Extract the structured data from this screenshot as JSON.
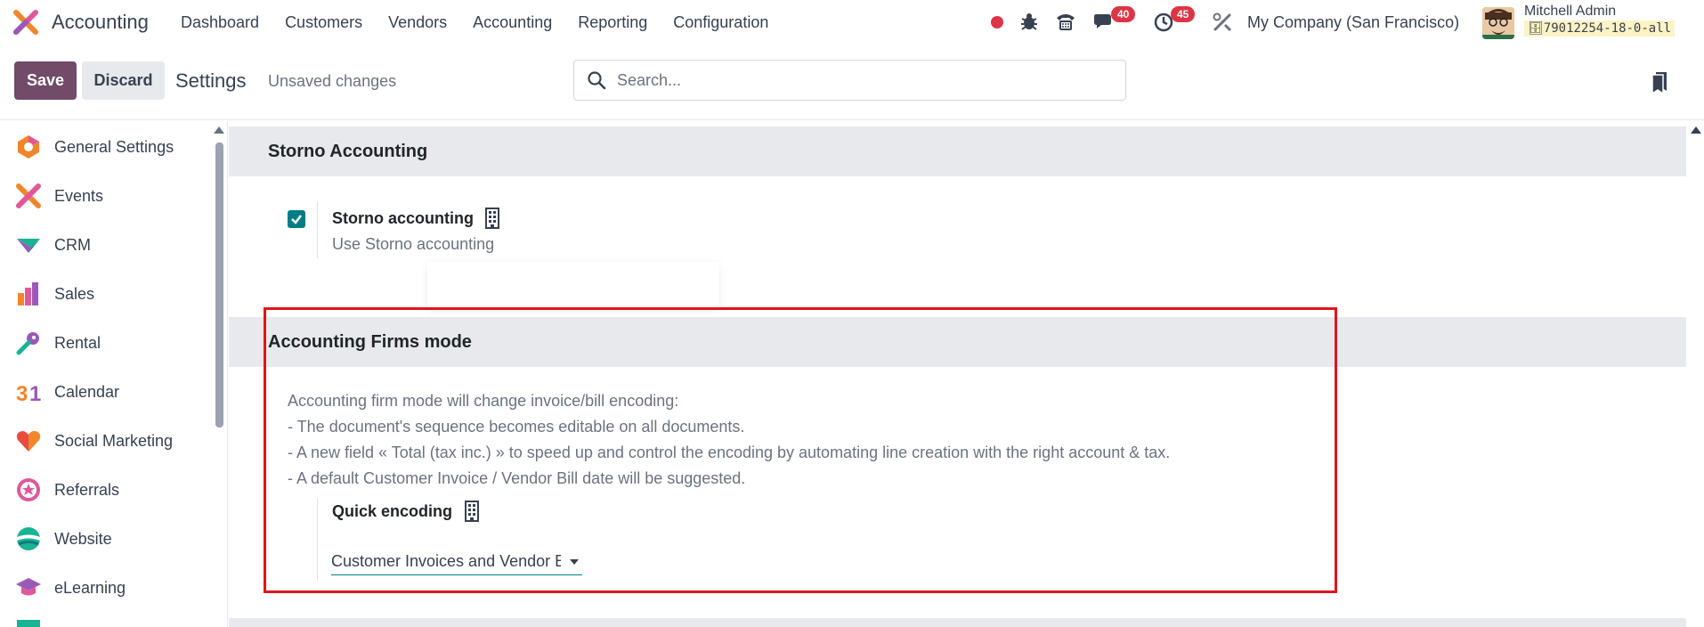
{
  "topnav": {
    "app_name": "Accounting",
    "menu": [
      "Dashboard",
      "Customers",
      "Vendors",
      "Accounting",
      "Reporting",
      "Configuration"
    ],
    "messages_count": "40",
    "activities_count": "45",
    "company": "My Company (San Francisco)",
    "user_name": "Mitchell Admin",
    "db_name": "79012254-18-0-all"
  },
  "controlbar": {
    "save_label": "Save",
    "discard_label": "Discard",
    "title": "Settings",
    "unsaved": "Unsaved changes",
    "search_placeholder": "Search..."
  },
  "sidebar": {
    "items": [
      {
        "label": "General Settings",
        "icon": "general-settings-icon"
      },
      {
        "label": "Events",
        "icon": "events-icon"
      },
      {
        "label": "CRM",
        "icon": "crm-icon"
      },
      {
        "label": "Sales",
        "icon": "sales-icon"
      },
      {
        "label": "Rental",
        "icon": "rental-icon"
      },
      {
        "label": "Calendar",
        "icon": "calendar-icon"
      },
      {
        "label": "Social Marketing",
        "icon": "social-marketing-icon"
      },
      {
        "label": "Referrals",
        "icon": "referrals-icon"
      },
      {
        "label": "Website",
        "icon": "website-icon"
      },
      {
        "label": "eLearning",
        "icon": "elearning-icon"
      }
    ]
  },
  "storno": {
    "header": "Storno Accounting",
    "title": "Storno accounting",
    "description": "Use Storno accounting",
    "checked": true
  },
  "firms": {
    "header": "Accounting Firms mode",
    "desc_line1": "Accounting firm mode will change invoice/bill encoding:",
    "desc_line2": "- The document's sequence becomes editable on all documents.",
    "desc_line3": "- A new field « Total (tax inc.) » to speed up and control the encoding by automating line creation with the right account & tax.",
    "desc_line4": "- A default Customer Invoice / Vendor Bill date will be suggested.",
    "quick_title": "Quick encoding",
    "quick_value": "Customer Invoices and Vendor Bills"
  },
  "colors": {
    "primary": "#714b67",
    "checkbox": "#017e84",
    "badge": "#dc3545",
    "highlight_border": "#e0141e"
  }
}
